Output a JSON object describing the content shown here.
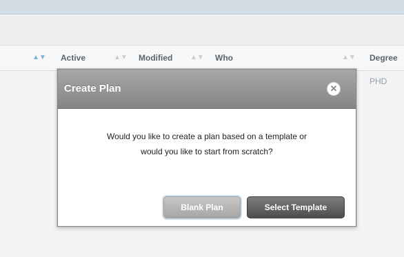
{
  "table": {
    "columns": [
      {
        "label": "Active"
      },
      {
        "label": "Modified"
      },
      {
        "label": "Who"
      },
      {
        "label": "Degree"
      }
    ],
    "sort_icon": "sort-arrows-icon",
    "rows": [
      {
        "degree": "PHD"
      }
    ]
  },
  "modal": {
    "title": "Create Plan",
    "close_icon": "close-icon",
    "message_line1": "Would you like to create a plan based on a template or",
    "message_line2": "would you like to start from scratch?",
    "blank_button": "Blank Plan",
    "template_button": "Select Template"
  },
  "colors": {
    "header_bar": "#d3dde6",
    "modal_header": "#969696",
    "primary_button": "#5c5c5c",
    "secondary_button": "#b5b5b5"
  }
}
